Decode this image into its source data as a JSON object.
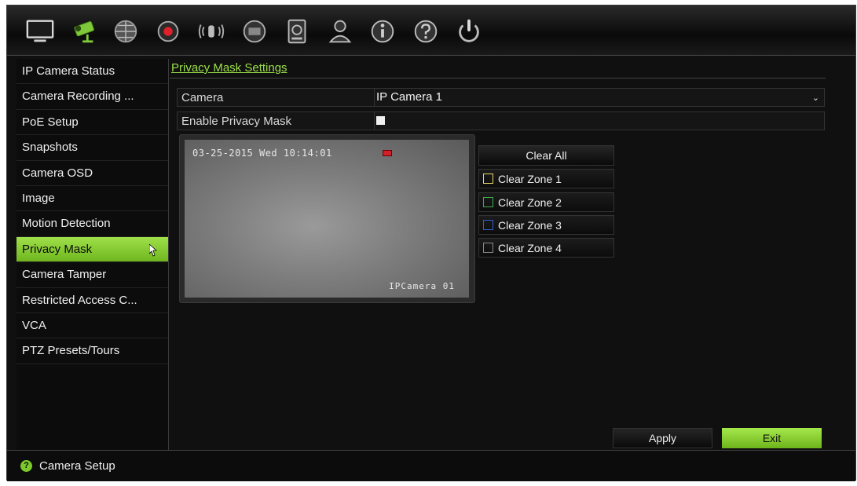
{
  "toolbar": {
    "icons": [
      "display-icon",
      "camera-icon",
      "network-icon",
      "record-icon",
      "alarm-icon",
      "device-icon",
      "hdd-icon",
      "user-icon",
      "info-icon",
      "help-icon",
      "power-icon"
    ],
    "active": "camera-icon"
  },
  "sidebar": {
    "items": [
      {
        "label": "IP Camera Status"
      },
      {
        "label": "Camera Recording ..."
      },
      {
        "label": "PoE Setup"
      },
      {
        "label": "Snapshots"
      },
      {
        "label": "Camera OSD"
      },
      {
        "label": "Image"
      },
      {
        "label": "Motion Detection"
      },
      {
        "label": "Privacy Mask",
        "active": true
      },
      {
        "label": "Camera Tamper"
      },
      {
        "label": "Restricted Access C..."
      },
      {
        "label": "VCA"
      },
      {
        "label": "PTZ Presets/Tours"
      }
    ]
  },
  "main": {
    "section_title": "Privacy Mask Settings",
    "camera_label": "Camera",
    "camera_value": "IP Camera 1",
    "enable_label": "Enable Privacy Mask",
    "enable_checked": false,
    "preview": {
      "date": "03-25-2015 Wed 10:14:01",
      "camera_name": "IPCamera 01"
    },
    "clear_all": "Clear All",
    "zones": [
      {
        "label": "Clear Zone 1",
        "color": "#e8d86a"
      },
      {
        "label": "Clear Zone 2",
        "color": "#3fae4a"
      },
      {
        "label": "Clear Zone 3",
        "color": "#2f5fd0"
      },
      {
        "label": "Clear Zone 4",
        "color": "#8a8a8a"
      }
    ],
    "apply_label": "Apply",
    "exit_label": "Exit"
  },
  "status": {
    "text": "Camera Setup"
  },
  "colors": {
    "accent": "#8fd63a"
  }
}
